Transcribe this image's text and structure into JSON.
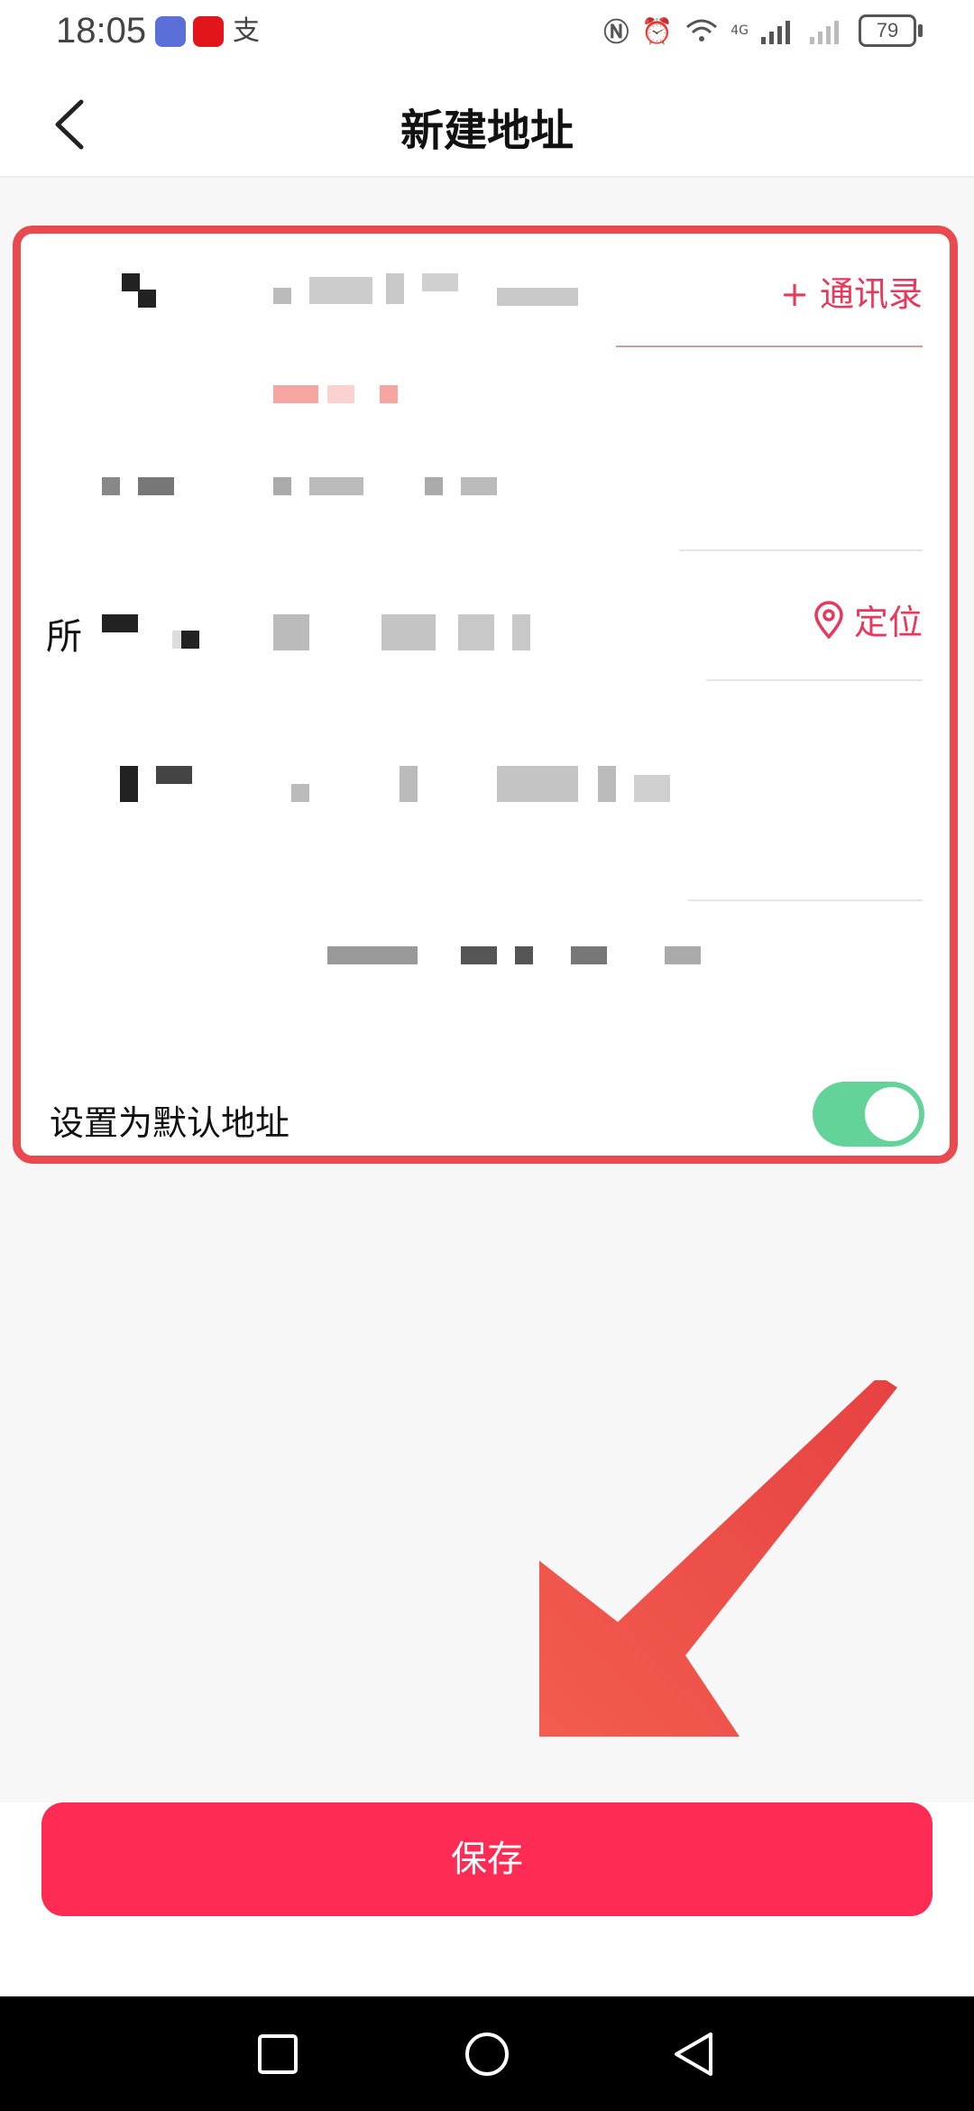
{
  "status_bar": {
    "time": "18:05",
    "battery": "79",
    "network": "4G"
  },
  "header": {
    "title": "新建地址"
  },
  "form": {
    "contacts_link": "+ 通讯录",
    "locate_link": "定位",
    "partial_label": "所",
    "default_label": "设置为默认地址",
    "default_enabled": true
  },
  "actions": {
    "save_label": "保存"
  },
  "colors": {
    "accent": "#fe2c55",
    "toggle_on": "#64d39a",
    "highlight_border": "#e84a4f"
  },
  "icons": [
    "back-icon",
    "location-pin-icon",
    "square-nav-icon",
    "circle-nav-icon",
    "triangle-nav-icon"
  ]
}
